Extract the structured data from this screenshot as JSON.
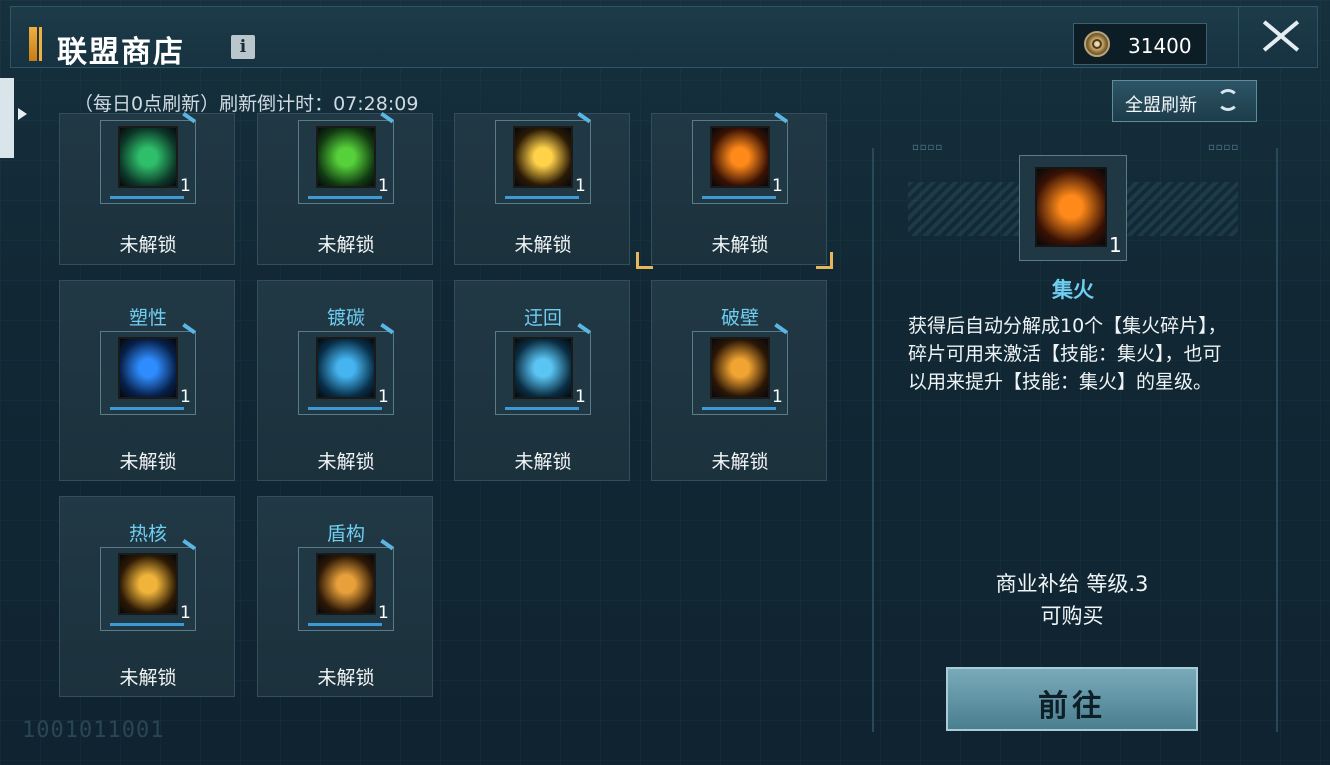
{
  "header": {
    "title": "联盟商店",
    "info_label": "i",
    "currency": "31400"
  },
  "refresh": {
    "info": "（每日0点刷新）刷新倒计时：07:28:09",
    "button_label": "全盟刷新"
  },
  "items": [
    {
      "name": "",
      "count": "1",
      "status": "未解锁",
      "icon": "green-vortex-icon",
      "colors": [
        "#0d3a2a",
        "#2fbf6a"
      ]
    },
    {
      "name": "",
      "count": "1",
      "status": "未解锁",
      "icon": "green-spike-icon",
      "colors": [
        "#123c12",
        "#56d13a"
      ]
    },
    {
      "name": "",
      "count": "1",
      "status": "未解锁",
      "icon": "spark-burst-icon",
      "colors": [
        "#2b1a05",
        "#ffd24a"
      ]
    },
    {
      "name": "",
      "count": "1",
      "status": "未解锁",
      "icon": "fire-icon",
      "colors": [
        "#3a1204",
        "#ff8a1a"
      ]
    },
    {
      "name": "塑性",
      "count": "1",
      "status": "未解锁",
      "icon": "blue-shield-icon",
      "colors": [
        "#06204a",
        "#2f8cff"
      ]
    },
    {
      "name": "镀碳",
      "count": "1",
      "status": "未解锁",
      "icon": "blue-ring-icon",
      "colors": [
        "#08304a",
        "#45b4f0"
      ]
    },
    {
      "name": "迂回",
      "count": "1",
      "status": "未解锁",
      "icon": "blue-wave-icon",
      "colors": [
        "#0a2e44",
        "#5ac4f2"
      ]
    },
    {
      "name": "破壁",
      "count": "1",
      "status": "未解锁",
      "icon": "mech-blast-icon",
      "colors": [
        "#2a1606",
        "#f2a432"
      ]
    },
    {
      "name": "热核",
      "count": "1",
      "status": "未解锁",
      "icon": "gold-core-icon",
      "colors": [
        "#2c1a04",
        "#f0b43a"
      ]
    },
    {
      "name": "盾构",
      "count": "1",
      "status": "未解锁",
      "icon": "gold-drill-icon",
      "colors": [
        "#2c1806",
        "#e8a03a"
      ]
    }
  ],
  "selected_index": 3,
  "detail": {
    "name": "集火",
    "count": "1",
    "description": "获得后自动分解成10个【集火碎片】，碎片可用来激活【技能：集火】，也可以用来提升【技能：集火】的星级。",
    "level": "商业补给 等级.3",
    "availability": "可购买",
    "button_label": "前往",
    "icon": "fire-icon"
  },
  "footer_code": "1001011001",
  "colors": {
    "accent": "#6fcdf0",
    "selection": "#e6b65a",
    "button": "#5f94a5"
  }
}
